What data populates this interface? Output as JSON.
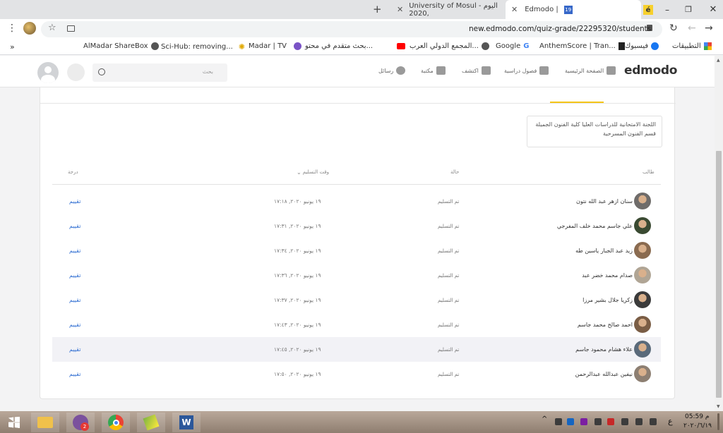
{
  "browser": {
    "tabs": [
      {
        "title": "Edmodo | ",
        "active": true
      },
      {
        "title": "University of Mosul - اليوم ,2020",
        "active": false
      }
    ],
    "url": "new.edmodo.com/quiz-grade/22295320/students",
    "bookmarks": [
      "التطبيقات",
      "فيسبوك",
      "AnthemScore | Tran...",
      "Google",
      "المجمع الدولي العرب...",
      "بحث متقدم في محتو...",
      "Madar | TV",
      "Sci-Hub: removing...",
      "AlMadar ShareBox"
    ]
  },
  "nav": {
    "logo": "edmodo",
    "items": [
      "الصفحة الرئيسية",
      "فصول دراسية",
      "اكتشف",
      "مكتبة",
      "رسائل"
    ],
    "search_placeholder": "بحث"
  },
  "card": {
    "description": "اللجنة الامتحانية للدراسات العليا كلية الفنون الجميلة قسم الفنون المسرحية",
    "columns": {
      "student": "طالب",
      "status": "حالة",
      "time": "وقت التسليم",
      "grade": "درجة"
    },
    "rows": [
      {
        "name": "سنان ازهر عبد الله نتون",
        "status": "تم التسليم",
        "time": "١٩ يونيو ٢٠٢٠, ١٧:١٨",
        "action": "تقييم"
      },
      {
        "name": "علي جاسم محمد خلف المفرجي",
        "status": "تم التسليم",
        "time": "١٩ يونيو ٢٠٢٠, ١٧:٣١",
        "action": "تقييم"
      },
      {
        "name": "زيد عبد الجبار ياسين طه",
        "status": "تم التسليم",
        "time": "١٩ يونيو ٢٠٢٠, ١٧:٣٤",
        "action": "تقييم"
      },
      {
        "name": "صدام محمد خضر عبد",
        "status": "تم التسليم",
        "time": "١٩ يونيو ٢٠٢٠, ١٧:٣٦",
        "action": "تقييم"
      },
      {
        "name": "زكريا جلال بشير مرزا",
        "status": "تم التسليم",
        "time": "١٩ يونيو ٢٠٢٠, ١٧:٣٧",
        "action": "تقييم"
      },
      {
        "name": "احمد صالح محمد جاسم",
        "status": "تم التسليم",
        "time": "١٩ يونيو ٢٠٢٠, ١٧:٤٣",
        "action": "تقييم"
      },
      {
        "name": "علاء هشام محمود جاسم",
        "status": "تم التسليم",
        "time": "١٩ يونيو ٢٠٢٠, ١٧:٤٥",
        "action": "تقييم"
      },
      {
        "name": "نيفين عبدالله عبدالرحمن",
        "status": "تم التسليم",
        "time": "١٩ يونيو ٢٠٢٠, ١٧:٥٠",
        "action": "تقييم"
      }
    ]
  },
  "taskbar": {
    "time": "05:59 م",
    "date": "٢٠٢٠/٦/١٩",
    "lang": "ع",
    "viber_badge": "2"
  },
  "colors": {
    "accent": "#f5c518",
    "link": "#2b6bd1",
    "brand_text": "#333333"
  }
}
